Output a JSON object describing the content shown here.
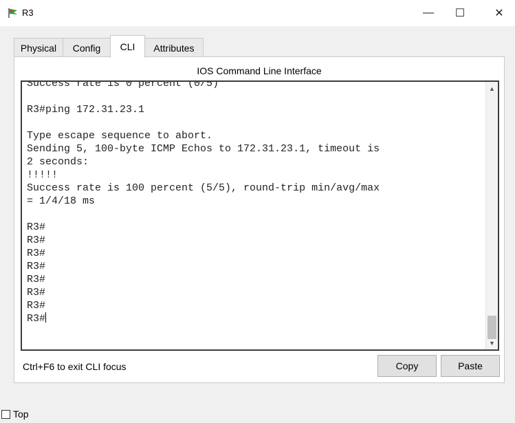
{
  "window": {
    "title": "R3",
    "minimize_label": "—",
    "maximize_label": "☐",
    "close_label": "✕",
    "icon": "router-icon"
  },
  "tabs": [
    {
      "label": "Physical",
      "active": false
    },
    {
      "label": "Config",
      "active": false
    },
    {
      "label": "CLI",
      "active": true
    },
    {
      "label": "Attributes",
      "active": false
    }
  ],
  "panel": {
    "title": "IOS Command Line Interface"
  },
  "console": {
    "text": "Success rate is 0 percent (0/5)\n\nR3#ping 172.31.23.1\n\nType escape sequence to abort.\nSending 5, 100-byte ICMP Echos to 172.31.23.1, timeout is\n2 seconds:\n!!!!!\nSuccess rate is 100 percent (5/5), round-trip min/avg/max\n= 1/4/18 ms\n\nR3#\nR3#\nR3#\nR3#\nR3#\nR3#\nR3#\nR3#",
    "cursor_visible": true
  },
  "footer": {
    "hint": "Ctrl+F6 to exit CLI focus",
    "copy_label": "Copy",
    "paste_label": "Paste"
  },
  "top_option": {
    "label": "Top",
    "checked": false
  },
  "colors": {
    "window_bg": "#f0f0f0",
    "panel_bg": "#ffffff",
    "console_border": "#3c3c3c",
    "button_bg": "#e1e1e1"
  }
}
